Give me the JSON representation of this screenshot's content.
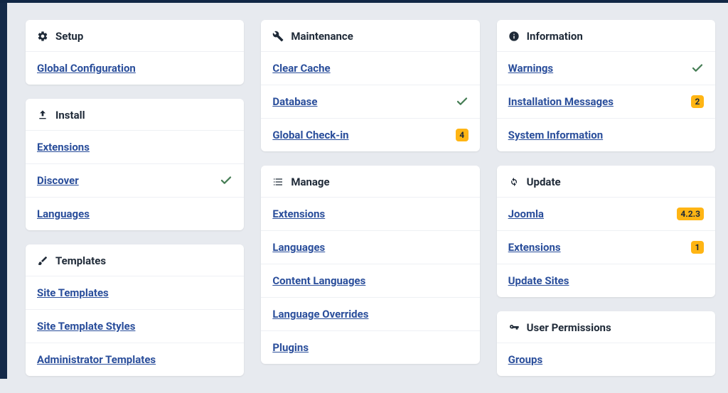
{
  "cards": {
    "setup": {
      "title": "Setup"
    },
    "install": {
      "title": "Install"
    },
    "templates": {
      "title": "Templates"
    },
    "maint": {
      "title": "Maintenance"
    },
    "manage": {
      "title": "Manage"
    },
    "info": {
      "title": "Information"
    },
    "update": {
      "title": "Update"
    },
    "userperm": {
      "title": "User Permissions"
    }
  },
  "items": {
    "globalConfig": {
      "label": "Global Configuration"
    },
    "installExtensions": {
      "label": "Extensions"
    },
    "discover": {
      "label": "Discover"
    },
    "installLanguages": {
      "label": "Languages"
    },
    "siteTemplates": {
      "label": "Site Templates"
    },
    "siteTemplateStyles": {
      "label": "Site Template Styles"
    },
    "adminTemplates": {
      "label": "Administrator Templates"
    },
    "clearCache": {
      "label": "Clear Cache"
    },
    "database": {
      "label": "Database"
    },
    "globalCheckin": {
      "label": "Global Check-in",
      "badge": "4"
    },
    "manageExtensions": {
      "label": "Extensions"
    },
    "manageLanguages": {
      "label": "Languages"
    },
    "contentLanguages": {
      "label": "Content Languages"
    },
    "languageOverrides": {
      "label": "Language Overrides"
    },
    "plugins": {
      "label": "Plugins"
    },
    "warnings": {
      "label": "Warnings"
    },
    "installMessages": {
      "label": "Installation Messages",
      "badge": "2"
    },
    "systemInfo": {
      "label": "System Information"
    },
    "joomla": {
      "label": "Joomla",
      "badge": "4.2.3"
    },
    "updateExtensions": {
      "label": "Extensions",
      "badge": "1"
    },
    "updateSites": {
      "label": "Update Sites"
    },
    "groups": {
      "label": "Groups"
    }
  }
}
